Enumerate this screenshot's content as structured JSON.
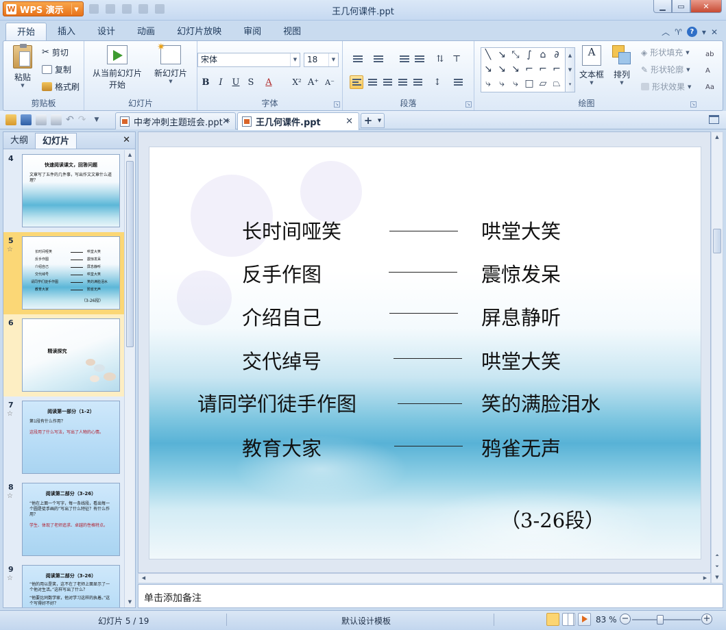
{
  "app": {
    "title": "王几何课件.ppt",
    "wps_label": "WPS 演示",
    "wps_logo": "W"
  },
  "ribbon_tabs": [
    "开始",
    "插入",
    "设计",
    "动画",
    "幻灯片放映",
    "审阅",
    "视图"
  ],
  "ribbon": {
    "clipboard": {
      "label": "剪贴板",
      "paste": "粘贴",
      "cut": "剪切",
      "copy": "复制",
      "format_painter": "格式刷"
    },
    "slides": {
      "label": "幻灯片",
      "from_current_line1": "从当前幻灯片",
      "from_current_line2": "开始",
      "new_slide": "新幻灯片"
    },
    "font": {
      "label": "字体",
      "font_name": "宋体",
      "font_size": "18"
    },
    "paragraph": {
      "label": "段落"
    },
    "drawing": {
      "label": "绘图",
      "textbox": "文本框",
      "arrange": "排列",
      "shape_fill": "形状填充",
      "shape_outline": "形状轮廓",
      "shape_effect": "形状效果"
    }
  },
  "doc_tabs": [
    {
      "label": "中考冲刺主题班会.ppt *",
      "active": false
    },
    {
      "label": "王几何课件.ppt",
      "active": true
    }
  ],
  "left_panel": {
    "tabs": [
      "大纲",
      "幻灯片"
    ],
    "active_tab": "幻灯片",
    "thumbnails": [
      {
        "num": "4",
        "title": "快速阅读课文，回答问题",
        "lines": [
          "文章写了五件的几件事，写出作文文章什么道理？"
        ]
      },
      {
        "num": "5",
        "selected": true,
        "rows": [
          [
            "长时间哑笑",
            "哄堂大笑"
          ],
          [
            "反手作图",
            "震惊发呆"
          ],
          [
            "介绍自己",
            "屏息静听"
          ],
          [
            "交代绰号",
            "哄堂大笑"
          ],
          [
            "请同学们徒手作图",
            "笑的满脸泪水"
          ],
          [
            "教育大家",
            "鸦雀无声"
          ]
        ],
        "note": "（3-26段）"
      },
      {
        "num": "6",
        "title": "精读探究"
      },
      {
        "num": "7",
        "title": "阅读第一部分（1-2）",
        "lines": [
          "第1段有什么作用？",
          "这段用了什么写法，写出了人物的心情。"
        ]
      },
      {
        "num": "8",
        "title": "阅读第二部分（3-26）",
        "lines": [
          "“他在上面一个写字，每一条线段，看出每一个圆是徒手画的”写出了什么特征？有什么作用？",
          "学生、体现了老师追求、卓越的性格特点。"
        ]
      },
      {
        "num": "9",
        "title": "阅读第二部分（3-26）",
        "lines": [
          "“他的用以是笑，这不在了老师上面显示了一个他对生活。”这样写出了什么？",
          "“他要比同数学家，他对学习这样的执着。”这个写得好不好？"
        ]
      }
    ]
  },
  "slide": {
    "rows": [
      {
        "left": "长时间哑笑",
        "right": "哄堂大笑"
      },
      {
        "left": "反手作图",
        "right": "震惊发呆"
      },
      {
        "left": "介绍自己",
        "right": "屏息静听"
      },
      {
        "left": "交代绰号",
        "right": "哄堂大笑"
      },
      {
        "left": "请同学们徒手作图",
        "right": "笑的满脸泪水"
      },
      {
        "left": "教育大家",
        "right": "鸦雀无声"
      }
    ],
    "note": "（3-26段）"
  },
  "notes_placeholder": "单击添加备注",
  "status": {
    "slide_count": "幻灯片 5 / 19",
    "template": "默认设计模板",
    "zoom": "83 %",
    "zoom_level_percent": 83
  },
  "colors": {
    "accent_orange": "#e7721b",
    "selected_thumb": "#fbd776",
    "ribbon_blue": "#dde9f7"
  }
}
